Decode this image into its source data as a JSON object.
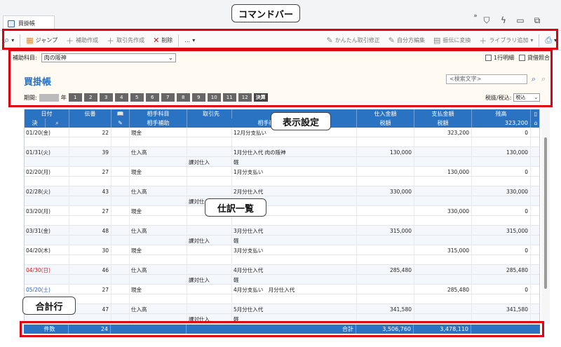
{
  "window": {
    "tab_title": "買掛帳"
  },
  "commandbar": {
    "jump": "ジャンプ",
    "add_sub": "補助作成",
    "add_partner": "取引先作成",
    "delete": "削除",
    "more": "…",
    "easy_edit": "かんたん取引修正",
    "compound_edit": "自分方編集",
    "transfer": "振伝に変換",
    "library_add": "ライブラリ追加"
  },
  "annotations": {
    "command": "コマンドバー",
    "display": "表示設定",
    "journal": "仕訳一覧",
    "total": "合計行"
  },
  "settings": {
    "sub_label": "補助科目:",
    "sub_value": "肉の阪神",
    "one_line": "1行明細",
    "combine": "貸借照合",
    "title": "買掛帳",
    "search_placeholder": "<検索文字>",
    "period_label": "期間:",
    "year_suffix": "年",
    "months": [
      "1",
      "2",
      "3",
      "4",
      "5",
      "6",
      "7",
      "8",
      "9",
      "10",
      "11",
      "12"
    ],
    "closing": "決算",
    "tax_label": "税抜/税込:",
    "tax_value": "税込"
  },
  "table": {
    "header1": {
      "date": "日付",
      "no": "伝番",
      "account": "相手科目",
      "partner": "取引先",
      "purchase": "仕入金額",
      "payment": "支払金額",
      "balance": "残高"
    },
    "header2": {
      "decision": "決",
      "sub": "相手補助",
      "taxclass": "相手税区分",
      "tax1": "税額",
      "tax2": "税額",
      "balance_val": "323,200"
    },
    "rows": [
      {
        "date": "01/20(金)",
        "no": "22",
        "account": "現金",
        "sub": "",
        "desc": "12月分支払い",
        "taxc": "",
        "purchase": "",
        "payment": "323,200",
        "balance": "0"
      },
      {
        "date": "",
        "no": "",
        "account": "",
        "sub": "",
        "desc": "",
        "taxc": "",
        "purchase": "",
        "payment": "",
        "balance": ""
      },
      {
        "date": "01/31(火)",
        "no": "39",
        "account": "仕入高",
        "sub": "",
        "desc": "1月分仕入代 肉の阪神",
        "taxc": "",
        "purchase": "130,000",
        "payment": "",
        "balance": "130,000"
      },
      {
        "date": "",
        "no": "",
        "account": "",
        "sub": "課対仕入",
        "desc": "軽",
        "taxc": "",
        "purchase": "",
        "payment": "",
        "balance": ""
      },
      {
        "date": "02/20(月)",
        "no": "27",
        "account": "現金",
        "sub": "",
        "desc": "1月分支払い",
        "taxc": "",
        "purchase": "",
        "payment": "130,000",
        "balance": "0"
      },
      {
        "date": "",
        "no": "",
        "account": "",
        "sub": "",
        "desc": "",
        "taxc": "",
        "purchase": "",
        "payment": "",
        "balance": ""
      },
      {
        "date": "02/28(火)",
        "no": "43",
        "account": "仕入高",
        "sub": "",
        "desc": "2月分仕入代",
        "taxc": "",
        "purchase": "330,000",
        "payment": "",
        "balance": "330,000"
      },
      {
        "date": "",
        "no": "",
        "account": "",
        "sub": "課対仕入",
        "desc": "",
        "taxc": "",
        "purchase": "",
        "payment": "",
        "balance": ""
      },
      {
        "date": "03/20(月)",
        "no": "27",
        "account": "現金",
        "sub": "",
        "desc": "",
        "taxc": "",
        "purchase": "",
        "payment": "330,000",
        "balance": "0"
      },
      {
        "date": "",
        "no": "",
        "account": "",
        "sub": "",
        "desc": "",
        "taxc": "",
        "purchase": "",
        "payment": "",
        "balance": ""
      },
      {
        "date": "03/31(金)",
        "no": "48",
        "account": "仕入高",
        "sub": "",
        "desc": "3月分仕入代",
        "taxc": "",
        "purchase": "315,000",
        "payment": "",
        "balance": "315,000"
      },
      {
        "date": "",
        "no": "",
        "account": "",
        "sub": "課対仕入",
        "desc": "軽",
        "taxc": "",
        "purchase": "",
        "payment": "",
        "balance": ""
      },
      {
        "date": "04/20(木)",
        "no": "30",
        "account": "現金",
        "sub": "",
        "desc": "3月分支払い",
        "taxc": "",
        "purchase": "",
        "payment": "315,000",
        "balance": "0"
      },
      {
        "date": "",
        "no": "",
        "account": "",
        "sub": "",
        "desc": "",
        "taxc": "",
        "purchase": "",
        "payment": "",
        "balance": ""
      },
      {
        "date": "04/30(日)",
        "no": "46",
        "account": "仕入高",
        "sub": "",
        "desc": "4月分仕入代",
        "taxc": "",
        "purchase": "285,480",
        "payment": "",
        "balance": "285,480",
        "color": "red"
      },
      {
        "date": "",
        "no": "",
        "account": "",
        "sub": "課対仕入",
        "desc": "軽",
        "taxc": "",
        "purchase": "",
        "payment": "",
        "balance": ""
      },
      {
        "date": "05/20(土)",
        "no": "27",
        "account": "現金",
        "sub": "",
        "desc": "4月分支払い　月分仕入代",
        "taxc": "",
        "purchase": "",
        "payment": "285,480",
        "balance": "0",
        "color": "blue"
      },
      {
        "date": "",
        "no": "",
        "account": "",
        "sub": "",
        "desc": "",
        "taxc": "",
        "purchase": "",
        "payment": "",
        "balance": ""
      },
      {
        "date": "",
        "no": "47",
        "account": "仕入高",
        "sub": "",
        "desc": "5月分仕入代",
        "taxc": "",
        "purchase": "341,580",
        "payment": "",
        "balance": "341,580"
      },
      {
        "date": "",
        "no": "",
        "account": "",
        "sub": "課対仕入",
        "desc": "軽",
        "taxc": "",
        "purchase": "",
        "payment": "",
        "balance": ""
      }
    ],
    "total": {
      "count_label": "件数",
      "count": "24",
      "sum_label": "合計",
      "purchase": "3,506,760",
      "payment": "3,478,110",
      "balance": ""
    }
  }
}
